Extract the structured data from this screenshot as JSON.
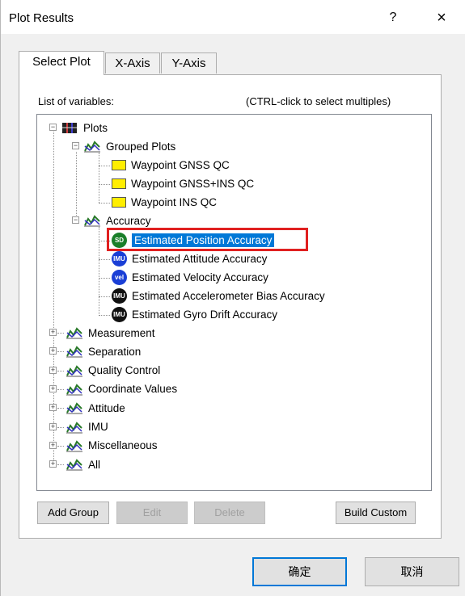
{
  "window": {
    "title": "Plot Results",
    "help_label": "?",
    "close_label": "×"
  },
  "tabs": [
    {
      "label": "Select Plot",
      "active": true
    },
    {
      "label": "X-Axis",
      "active": false
    },
    {
      "label": "Y-Axis",
      "active": false
    }
  ],
  "list_label": "List of variables:",
  "list_hint": "(CTRL-click to select multiples)",
  "tree": {
    "root": {
      "label": "Plots",
      "icon": "plots-grid-icon",
      "expanded": true
    },
    "grouped": {
      "label": "Grouped Plots",
      "icon": "plot-chart-icon",
      "expanded": true,
      "children": [
        {
          "label": "Waypoint GNSS QC",
          "icon": "folder-icon"
        },
        {
          "label": "Waypoint GNSS+INS QC",
          "icon": "folder-icon"
        },
        {
          "label": "Waypoint INS QC",
          "icon": "folder-icon"
        }
      ]
    },
    "accuracy": {
      "label": "Accuracy",
      "icon": "plot-chart-icon",
      "expanded": true,
      "children": [
        {
          "label": "Estimated Position Accuracy",
          "badge": "SD",
          "badge_color": "#1a7f2a",
          "selected": true
        },
        {
          "label": "Estimated Attitude Accuracy",
          "badge": "IMU",
          "badge_color": "#1a3fd6",
          "selected": false
        },
        {
          "label": "Estimated Velocity Accuracy",
          "badge": "vel",
          "badge_color": "#1a3fd6",
          "selected": false
        },
        {
          "label": "Estimated Accelerometer Bias Accuracy",
          "badge": "IMU",
          "badge_color": "#111111",
          "selected": false
        },
        {
          "label": "Estimated Gyro Drift Accuracy",
          "badge": "IMU",
          "badge_color": "#111111",
          "selected": false
        }
      ]
    },
    "collapsed_groups": [
      {
        "label": "Measurement"
      },
      {
        "label": "Separation"
      },
      {
        "label": "Quality Control"
      },
      {
        "label": "Coordinate Values"
      },
      {
        "label": "Attitude"
      },
      {
        "label": "IMU"
      },
      {
        "label": "Miscellaneous"
      },
      {
        "label": "All"
      }
    ]
  },
  "buttons": {
    "add_group": {
      "label": "Add Group",
      "enabled": true
    },
    "edit": {
      "label": "Edit",
      "enabled": false
    },
    "delete": {
      "label": "Delete",
      "enabled": false
    },
    "build_custom": {
      "label": "Build Custom",
      "enabled": true
    },
    "ok": {
      "label": "确定"
    },
    "cancel": {
      "label": "取消"
    }
  },
  "colors": {
    "selection": "#0078d7",
    "highlight_box": "#e02020",
    "folder": "#ffee00"
  }
}
